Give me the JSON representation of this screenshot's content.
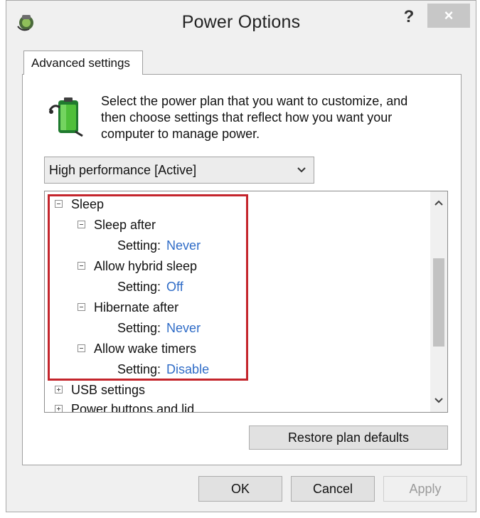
{
  "window": {
    "title": "Power Options",
    "help_label": "?",
    "close_label": "×",
    "app_icon": "power-plan-icon"
  },
  "tab": {
    "label": "Advanced settings"
  },
  "intro": {
    "icon": "battery-plan-icon",
    "text": "Select the power plan that you want to customize, and then choose settings that reflect how you want your computer to manage power."
  },
  "plan_select": {
    "value": "High performance [Active]"
  },
  "tree": {
    "sleep": {
      "label": "Sleep"
    },
    "items": [
      {
        "label": "Sleep after",
        "setting_label": "Setting:",
        "value": "Never"
      },
      {
        "label": "Allow hybrid sleep",
        "setting_label": "Setting:",
        "value": "Off"
      },
      {
        "label": "Hibernate after",
        "setting_label": "Setting:",
        "value": "Never"
      },
      {
        "label": "Allow wake timers",
        "setting_label": "Setting:",
        "value": "Disable"
      }
    ],
    "usb": {
      "label": "USB settings"
    },
    "power_buttons": {
      "label": "Power buttons and lid"
    },
    "highlight_color": "#c4252c",
    "value_color": "#2f6cc7"
  },
  "buttons": {
    "restore": "Restore plan defaults",
    "ok": "OK",
    "cancel": "Cancel",
    "apply": "Apply"
  }
}
